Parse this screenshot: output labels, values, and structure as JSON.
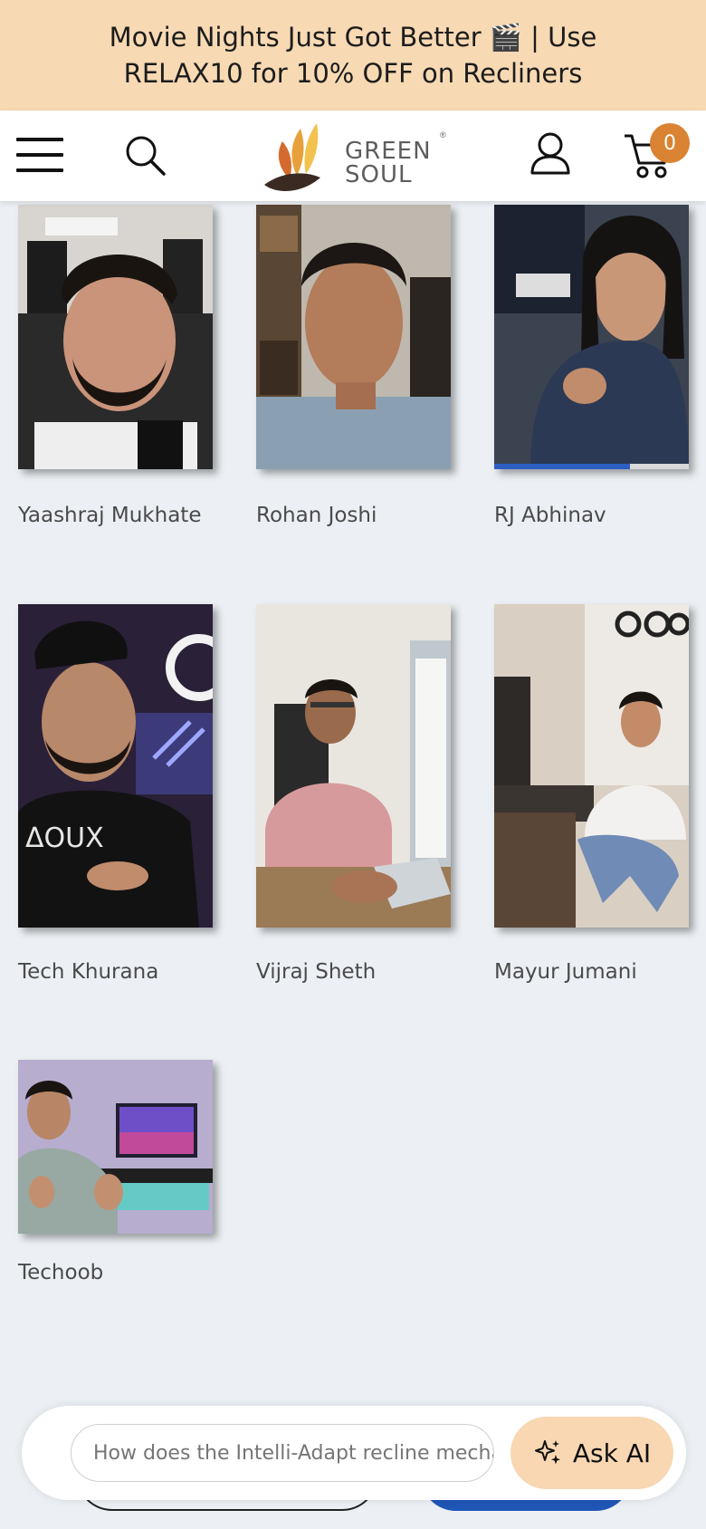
{
  "announcement": {
    "line1": "Movie Nights Just Got Better 🎬 | Use",
    "line2": "RELAX10 for 10% OFF on Recliners"
  },
  "header": {
    "logo_line1": "GREEN",
    "logo_line2": "SOUL",
    "logo_mark": "®",
    "cart_count": "0",
    "icons": [
      "menu-icon",
      "search-icon",
      "user-icon",
      "cart-icon"
    ]
  },
  "creators": [
    {
      "name": "Yaashraj Mukhate"
    },
    {
      "name": "Rohan Joshi"
    },
    {
      "name": "RJ Abhinav"
    },
    {
      "name": "Tech Khurana"
    },
    {
      "name": "Vijraj Sheth"
    },
    {
      "name": "Mayur Jumani"
    },
    {
      "name": "Techoob"
    }
  ],
  "ai_assistant": {
    "placeholder": "How does the Intelli-Adapt recline mechanism work?",
    "button_label": "Ask AI",
    "icon": "sparkle-icon"
  },
  "colors": {
    "announcement_bg": "#f7d9b3",
    "cart_badge": "#d98333",
    "ask_ai_bg": "#f8d7b2",
    "page_bg": "#ecf0f4"
  }
}
